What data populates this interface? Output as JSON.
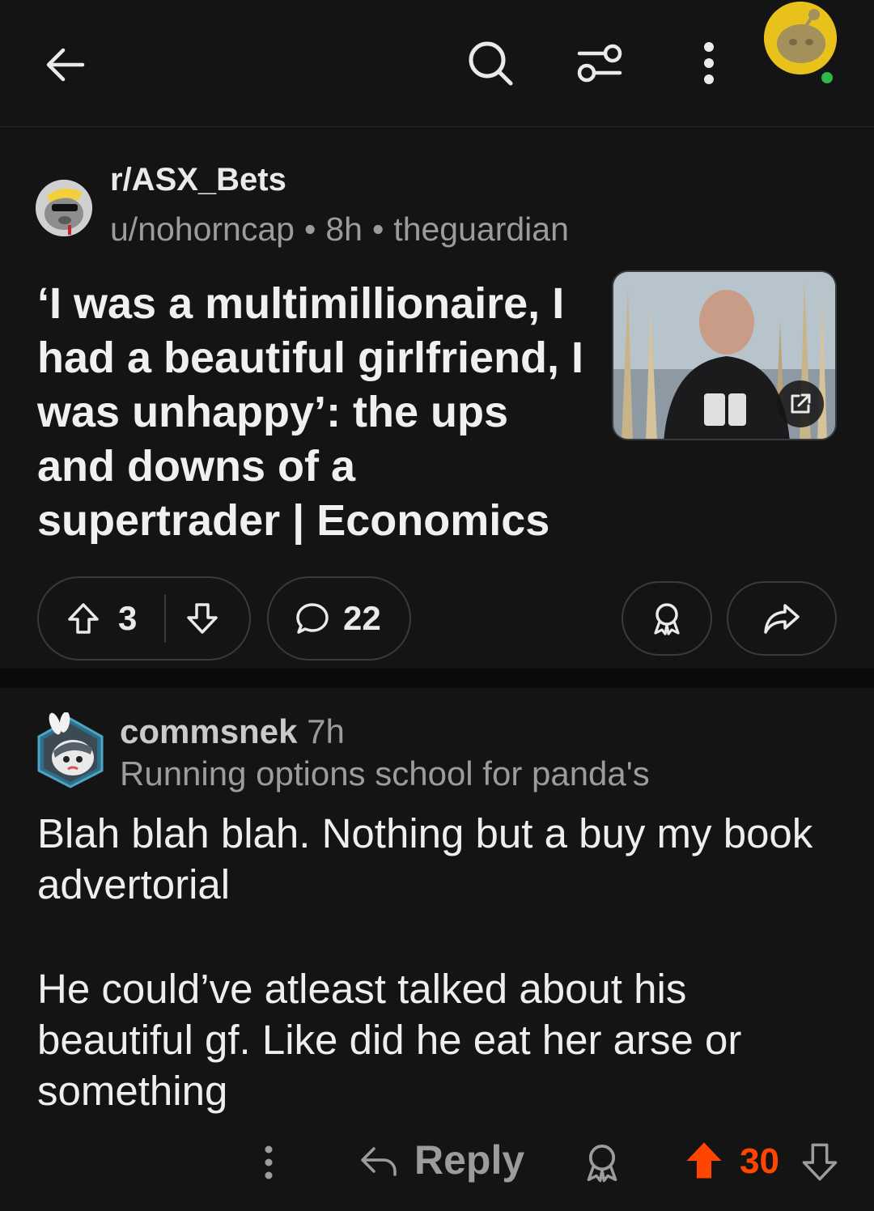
{
  "topbar": {
    "back_icon": "arrow-left-icon",
    "search_icon": "search-icon",
    "filter_icon": "sliders-icon",
    "more_icon": "more-vertical-icon",
    "avatar": "user-avatar-snoo",
    "online": true
  },
  "post": {
    "subreddit": "r/ASX_Bets",
    "author": "u/nohorncap",
    "age": "8h",
    "domain": "theguardian",
    "title": "‘I was a multimillionaire, I had a beautiful girlfriend, I was unhappy’: the ups and downs of a supertrader | Economics",
    "thumbnail_alt": "article thumbnail",
    "score": "3",
    "comments": "22"
  },
  "comment": {
    "author": "commsnek",
    "age": "7h",
    "flair": "Running options school for panda's",
    "body_p1": "Blah blah blah. Nothing but a buy my book advertorial",
    "body_p2": "He could’ve atleast talked about his beautiful gf. Like did he eat her arse or something",
    "reply_label": "Reply",
    "score": "30",
    "upvoted": true
  },
  "colors": {
    "background": "#141414",
    "accent_upvote": "#ff4500",
    "online_dot": "#2eb84b",
    "avatar_yellow": "#e8c21a"
  }
}
